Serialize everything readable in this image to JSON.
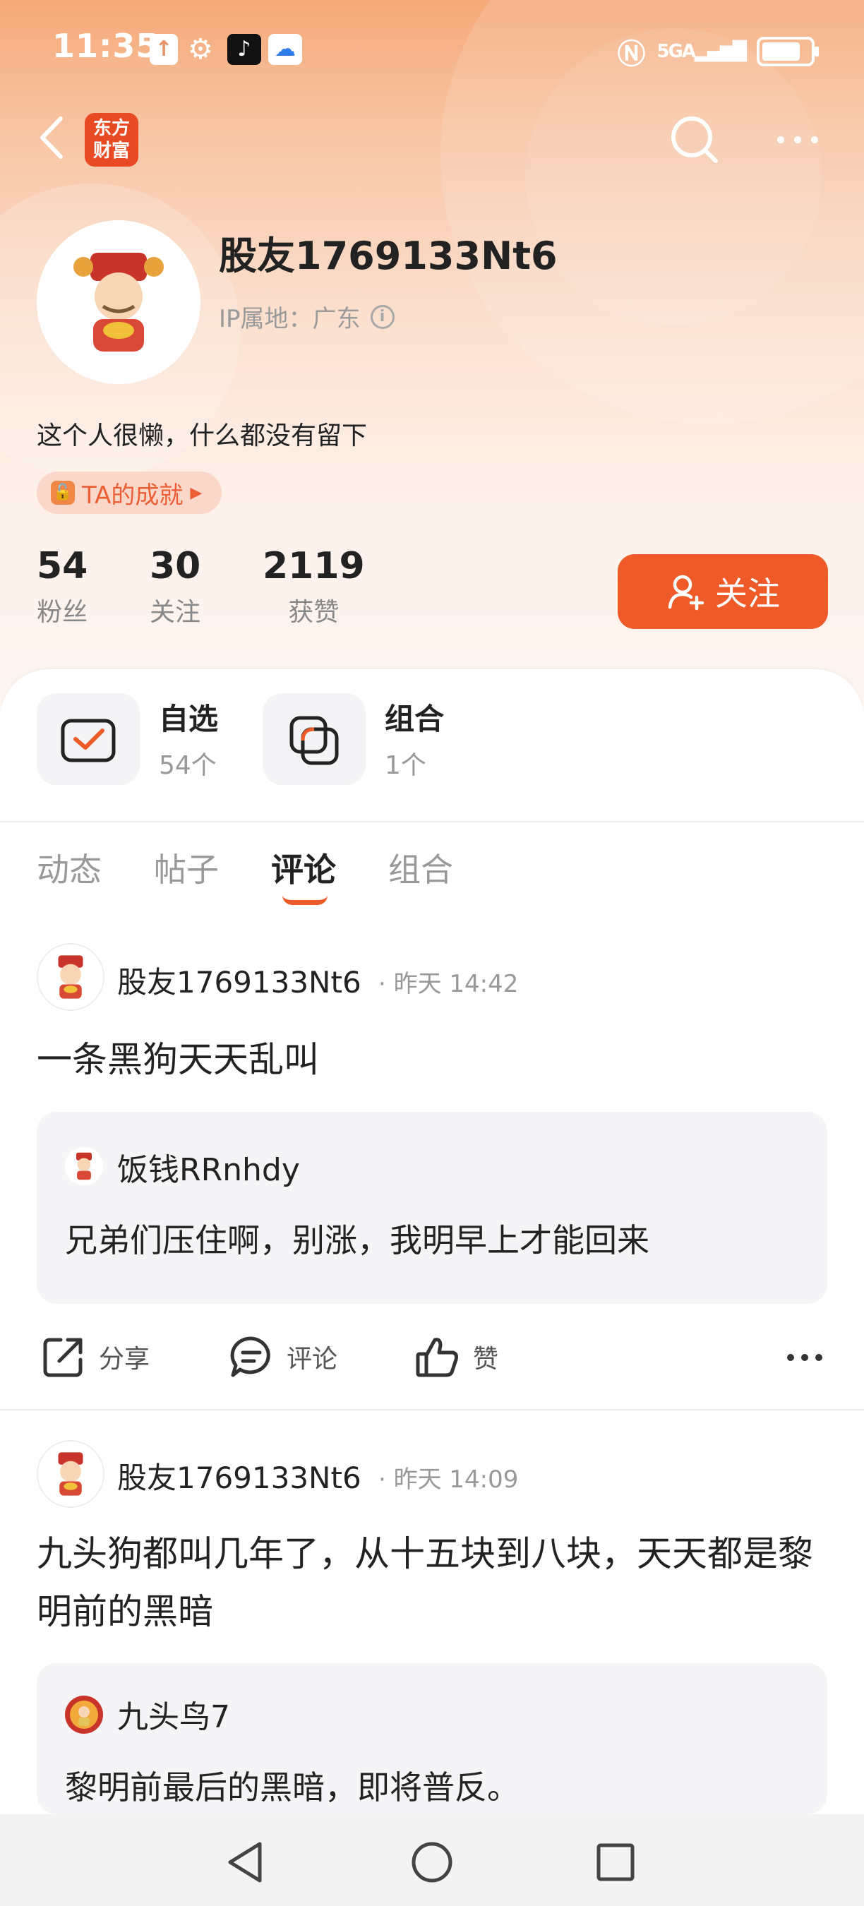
{
  "status_bar": {
    "time": "11:35",
    "network": "5GA",
    "battery_level": 0.8
  },
  "top_nav": {
    "logo_line1": "东方",
    "logo_line2": "财富"
  },
  "profile": {
    "username": "股友1769133Nt6",
    "ip_location": "IP属地：广东",
    "bio": "这个人很懒，什么都没有留下",
    "achievement_label": "TA的成就",
    "stats": [
      {
        "value": "54",
        "label": "粉丝"
      },
      {
        "value": "30",
        "label": "关注"
      },
      {
        "value": "2119",
        "label": "获赞"
      }
    ],
    "follow_label": "关注"
  },
  "shortcuts": [
    {
      "title": "自选",
      "sub": "54个"
    },
    {
      "title": "组合",
      "sub": "1个"
    }
  ],
  "tabs": [
    {
      "label": "动态"
    },
    {
      "label": "帖子"
    },
    {
      "label": "评论"
    },
    {
      "label": "组合"
    }
  ],
  "active_tab": "评论",
  "posts": [
    {
      "author": "股友1769133Nt6",
      "time": "· 昨天 14:42",
      "text": "一条黑狗天天乱叫",
      "quote_author": "饭钱RRnhdy",
      "quote_text": "兄弟们压住啊，别涨，我明早上才能回来"
    },
    {
      "author": "股友1769133Nt6",
      "time": "· 昨天 14:09",
      "text": "九头狗都叫几年了，从十五块到八块，天天都是黎明前的黑暗",
      "quote_author": "九头鸟7",
      "quote_text": "黎明前最后的黑暗，即将普反。"
    }
  ],
  "actions": {
    "share": "分享",
    "comment": "评论",
    "like": "赞"
  },
  "colors": {
    "accent": "#ee5a28",
    "header_top": "#f5a978",
    "quote_bg": "#f5f5f7"
  }
}
